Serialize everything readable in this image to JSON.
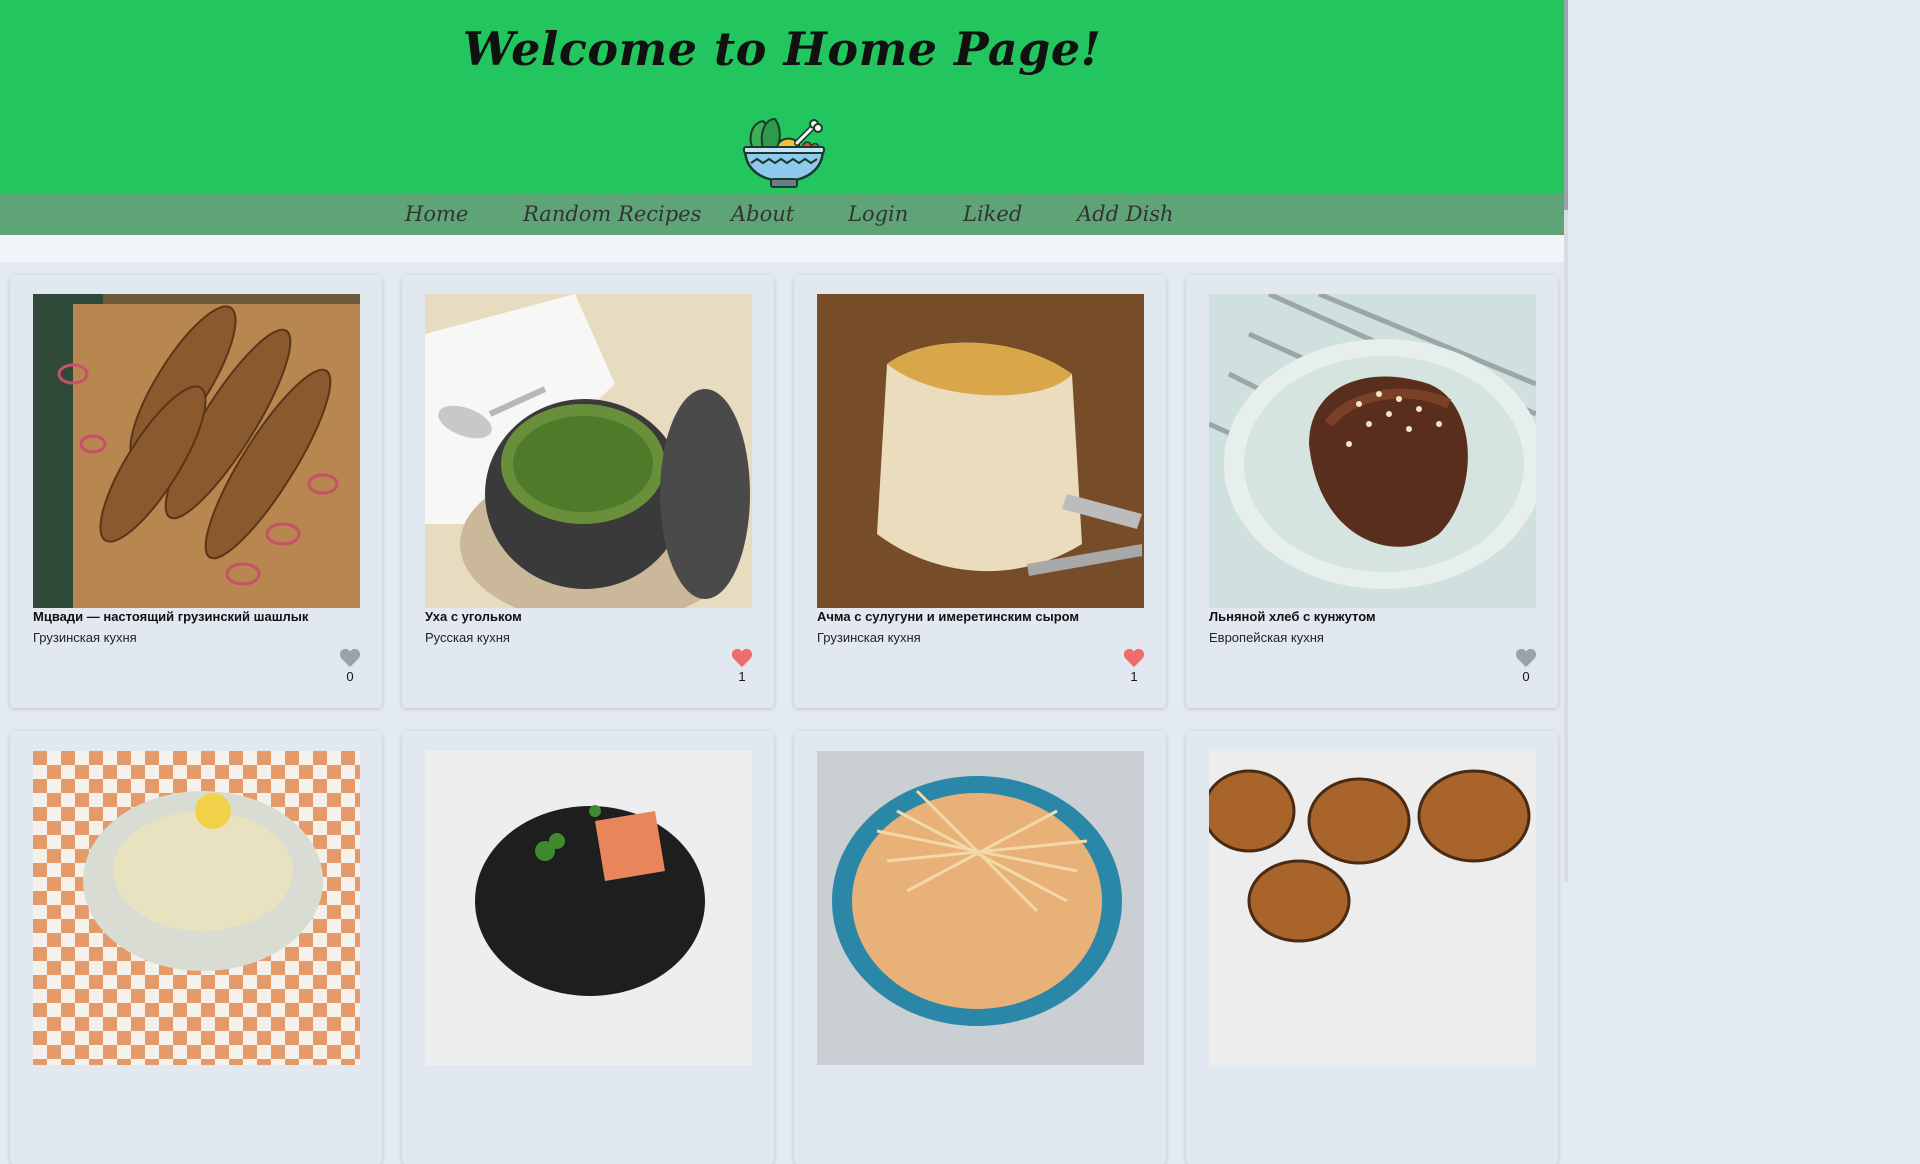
{
  "header": {
    "title": "Welcome to Home Page!",
    "logo_icon": "salad-bowl-icon"
  },
  "nav": {
    "items": [
      {
        "label": "Home"
      },
      {
        "label": "Random Recipes"
      },
      {
        "label": "About"
      },
      {
        "label": "Login"
      },
      {
        "label": "Liked"
      },
      {
        "label": "Add Dish"
      }
    ]
  },
  "colors": {
    "header_bg": "#22c55e",
    "nav_bg": "#5fa476",
    "liked_heart": "#f06b6b",
    "unliked_heart": "#9aa3ad",
    "page_bg": "#e3e9f0"
  },
  "recipes": [
    {
      "title": "Мцвади — настоящий грузинский шашлык",
      "cuisine": "Грузинская кухня",
      "likes": "0",
      "liked": false
    },
    {
      "title": "Уха с угольком",
      "cuisine": "Русская кухня",
      "likes": "1",
      "liked": true
    },
    {
      "title": "Ачма с сулугуни и имеретинским сыром",
      "cuisine": "Грузинская кухня",
      "likes": "1",
      "liked": true
    },
    {
      "title": "Льняной хлеб с кунжутом",
      "cuisine": "Европейская кухня",
      "likes": "0",
      "liked": false
    }
  ]
}
